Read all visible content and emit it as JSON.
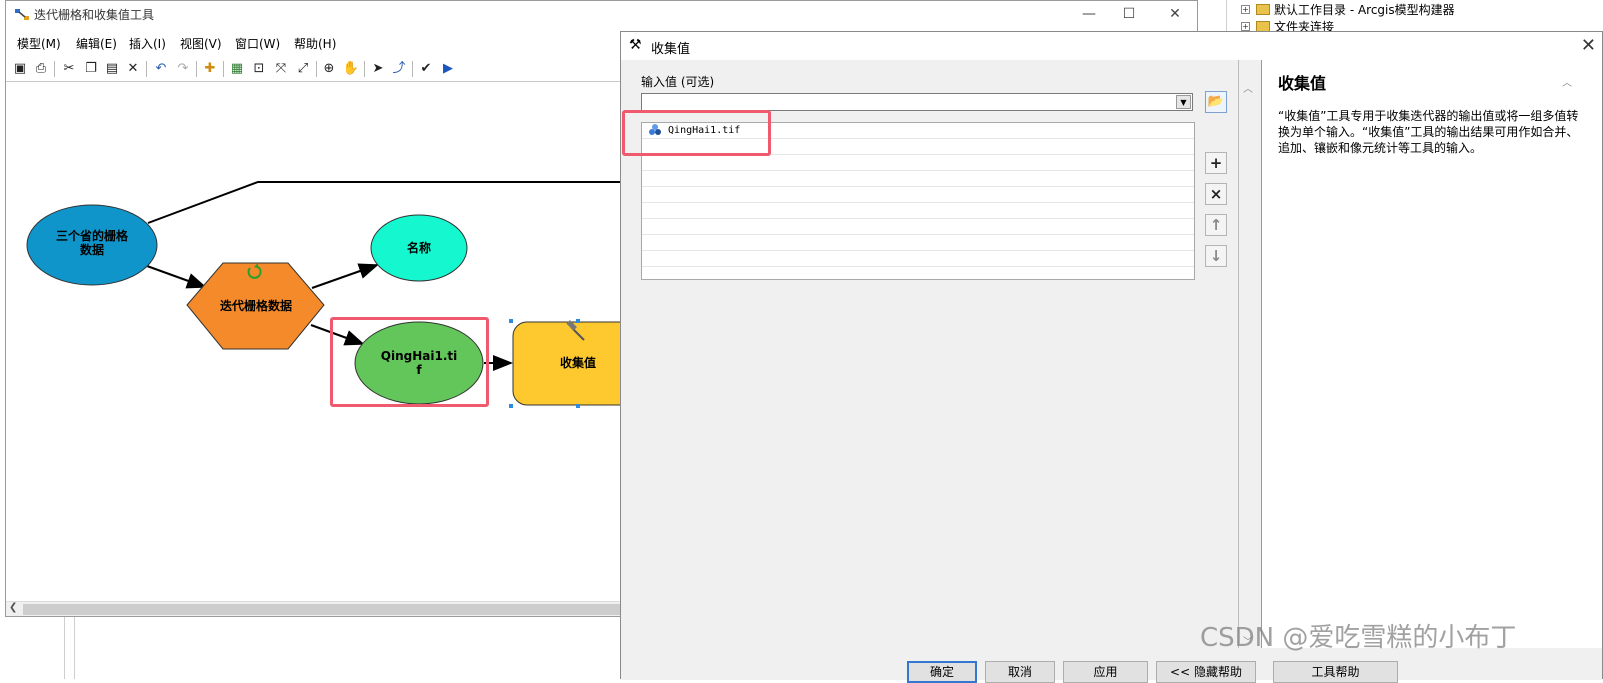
{
  "catalog": {
    "items": [
      {
        "label": "默认工作目录 - Arcgis模型构建器"
      },
      {
        "label": "文件夹连接"
      }
    ]
  },
  "model_builder": {
    "title": "迭代栅格和收集值工具",
    "window_controls": {
      "minimize": "—",
      "maximize": "☐",
      "close": "✕"
    },
    "menu": [
      {
        "label": "模型(M)"
      },
      {
        "label": "编辑(E)"
      },
      {
        "label": "插入(I)"
      },
      {
        "label": "视图(V)"
      },
      {
        "label": "窗口(W)"
      },
      {
        "label": "帮助(H)"
      }
    ],
    "diagram": {
      "nodes": {
        "input_data": "三个省的栅格\n数据",
        "iterator": "迭代栅格数据",
        "name": "名称",
        "raster_output": "QingHai1.ti\nf",
        "collect_values": "收集值"
      },
      "colors": {
        "input_data": "#0f95c9",
        "iterator": "#f58a2b",
        "name": "#14f7cf",
        "raster_output": "#62c65a",
        "collect_values": "#fec92e"
      }
    }
  },
  "dialog": {
    "title": "收集值",
    "field_label": "输入值 (可选)",
    "combo_value": "",
    "list_items": [
      "QingHai1.tif",
      "",
      "",
      "",
      "",
      "",
      "",
      "",
      "",
      ""
    ],
    "side_buttons": {
      "add": "+",
      "remove": "×",
      "up": "↑",
      "down": "↓"
    },
    "help": {
      "title": "收集值",
      "text": "“收集值”工具专用于收集迭代器的输出值或将一组多值转换为单个输入。“收集值”工具的输出结果可用作如合并、追加、镶嵌和像元统计等工具的输入。"
    },
    "buttons": {
      "ok": "确定",
      "cancel": "取消",
      "apply": "应用",
      "hide_help": "<< 隐藏帮助",
      "tool_help": "工具帮助"
    }
  },
  "watermark": "CSDN @爱吃雪糕的小布丁"
}
